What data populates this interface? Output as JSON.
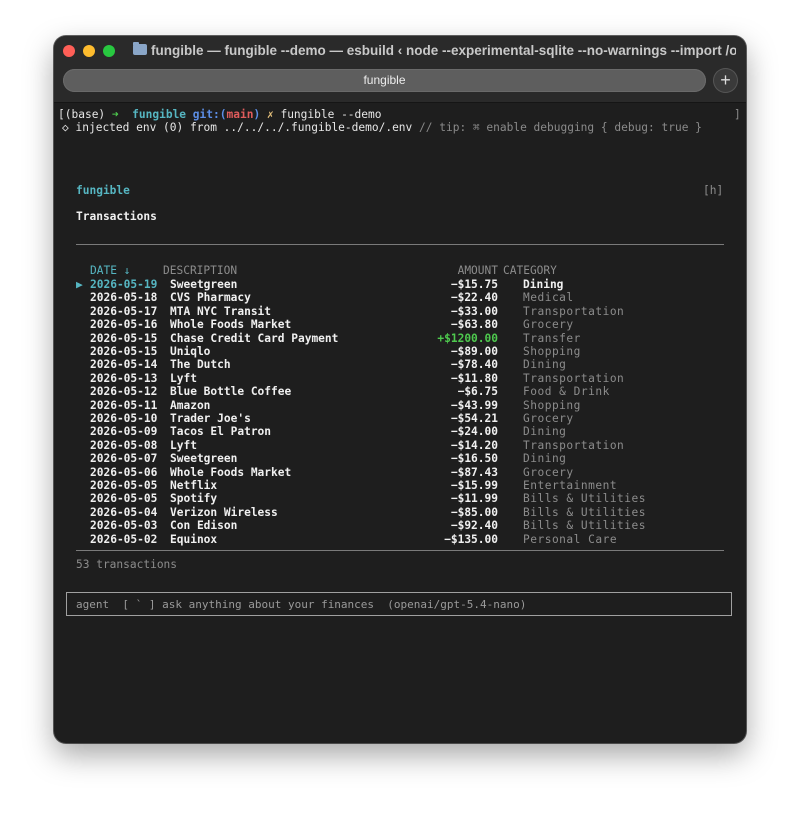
{
  "window": {
    "title": "fungible — fungible --demo — esbuild ‹ node --experimental-sqlite --no-warnings --import /opt..."
  },
  "tab": {
    "label": "fungible"
  },
  "new_tab_label": "+",
  "prompt": {
    "base": "(base)",
    "arrow": "➜",
    "dir": "fungible",
    "git_label": "git:",
    "git_open": "(",
    "branch": "main",
    "git_close": ")",
    "dirty": "✗",
    "command": "fungible --demo",
    "left_bracket": "[",
    "right_bracket": "]"
  },
  "env_line": {
    "bullet": "◇",
    "text": "injected env (0) from ../../../.fungible-demo/.env",
    "tip": "// tip: ⌘ enable debugging { debug: true }"
  },
  "app": {
    "name": "fungible",
    "help_hint": "[h]",
    "view_title": "Transactions"
  },
  "table": {
    "headers": {
      "date": "DATE ↓",
      "description": "DESCRIPTION",
      "amount": "AMOUNT",
      "category": "CATEGORY"
    },
    "selected_marker": "▶",
    "rows": [
      {
        "date": "2026-05-19",
        "description": "Sweetgreen",
        "amount": "−$15.75",
        "category": "Dining",
        "selected": true
      },
      {
        "date": "2026-05-18",
        "description": "CVS Pharmacy",
        "amount": "−$22.40",
        "category": "Medical"
      },
      {
        "date": "2026-05-17",
        "description": "MTA NYC Transit",
        "amount": "−$33.00",
        "category": "Transportation"
      },
      {
        "date": "2026-05-16",
        "description": "Whole Foods Market",
        "amount": "−$63.80",
        "category": "Grocery"
      },
      {
        "date": "2026-05-15",
        "description": "Chase Credit Card Payment",
        "amount": "+$1200.00",
        "category": "Transfer",
        "positive": true
      },
      {
        "date": "2026-05-15",
        "description": "Uniqlo",
        "amount": "−$89.00",
        "category": "Shopping"
      },
      {
        "date": "2026-05-14",
        "description": "The Dutch",
        "amount": "−$78.40",
        "category": "Dining"
      },
      {
        "date": "2026-05-13",
        "description": "Lyft",
        "amount": "−$11.80",
        "category": "Transportation"
      },
      {
        "date": "2026-05-12",
        "description": "Blue Bottle Coffee",
        "amount": "−$6.75",
        "category": "Food & Drink"
      },
      {
        "date": "2026-05-11",
        "description": "Amazon",
        "amount": "−$43.99",
        "category": "Shopping"
      },
      {
        "date": "2026-05-10",
        "description": "Trader Joe's",
        "amount": "−$54.21",
        "category": "Grocery"
      },
      {
        "date": "2026-05-09",
        "description": "Tacos El Patron",
        "amount": "−$24.00",
        "category": "Dining"
      },
      {
        "date": "2026-05-08",
        "description": "Lyft",
        "amount": "−$14.20",
        "category": "Transportation"
      },
      {
        "date": "2026-05-07",
        "description": "Sweetgreen",
        "amount": "−$16.50",
        "category": "Dining"
      },
      {
        "date": "2026-05-06",
        "description": "Whole Foods Market",
        "amount": "−$87.43",
        "category": "Grocery"
      },
      {
        "date": "2026-05-05",
        "description": "Netflix",
        "amount": "−$15.99",
        "category": "Entertainment"
      },
      {
        "date": "2026-05-05",
        "description": "Spotify",
        "amount": "−$11.99",
        "category": "Bills & Utilities"
      },
      {
        "date": "2026-05-04",
        "description": "Verizon Wireless",
        "amount": "−$85.00",
        "category": "Bills & Utilities"
      },
      {
        "date": "2026-05-03",
        "description": "Con Edison",
        "amount": "−$92.40",
        "category": "Bills & Utilities"
      },
      {
        "date": "2026-05-02",
        "description": "Equinox",
        "amount": "−$135.00",
        "category": "Personal Care"
      }
    ],
    "count_label": "53 transactions"
  },
  "agent": {
    "label": "agent",
    "shortcut": "[ ` ]",
    "placeholder": "ask anything about your finances",
    "model": "(openai/gpt-5.4-nano)"
  },
  "colors": {
    "accent": "#56b6c2",
    "positive": "#4ec94e",
    "branch": "#e05c5c",
    "git": "#5c8ee6",
    "background": "#1e1e1e"
  }
}
